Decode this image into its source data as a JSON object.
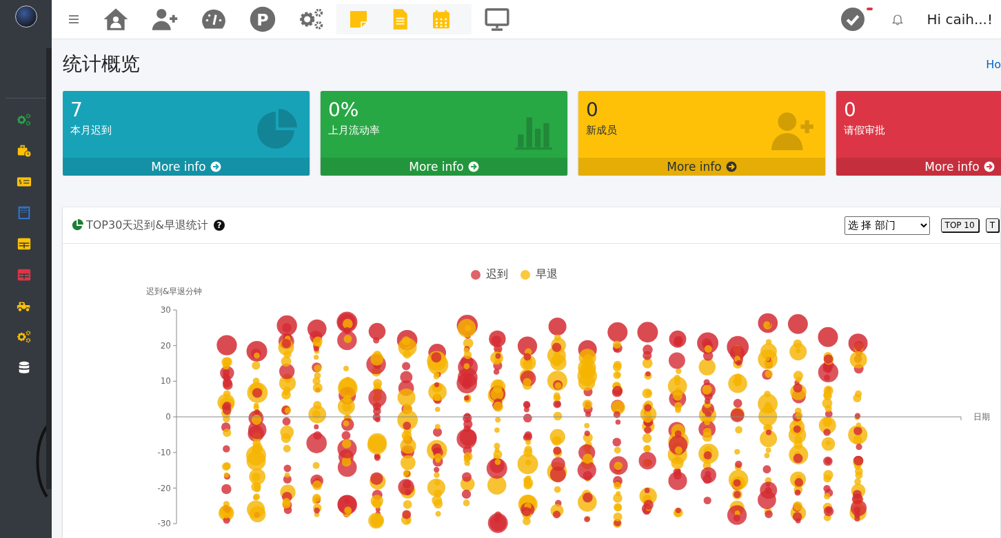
{
  "nav_icons": [
    {
      "kind": "home",
      "selected": false
    },
    {
      "kind": "user-plus",
      "selected": false
    },
    {
      "kind": "gauge",
      "selected": false
    },
    {
      "kind": "parking",
      "selected": false,
      "text": "P"
    },
    {
      "kind": "gears",
      "selected": false
    },
    {
      "kind": "note",
      "selected": true
    },
    {
      "kind": "document",
      "selected": true
    },
    {
      "kind": "calendar",
      "selected": true
    },
    {
      "kind": "monitor",
      "selected": false
    }
  ],
  "user": {
    "greeting": "Hi caih...!",
    "has_alert": true
  },
  "sidebar_items": [
    {
      "kind": "gears",
      "color": "#28a745"
    },
    {
      "kind": "briefcase",
      "color": "#ffc107"
    },
    {
      "kind": "card",
      "color": "#ffc107"
    },
    {
      "kind": "calendar",
      "color": "#2f7de1"
    },
    {
      "kind": "table",
      "color": "#ffc107"
    },
    {
      "kind": "table",
      "color": "#dc3545"
    },
    {
      "kind": "truck",
      "color": "#ffc107"
    },
    {
      "kind": "gears",
      "color": "#ffc107"
    },
    {
      "kind": "database",
      "color": "#ffffff"
    }
  ],
  "page_title": "统计概览",
  "breadcrumb": "Ho",
  "stat_boxes": [
    {
      "value": "7",
      "label": "本月迟到",
      "link": "More info",
      "color": "#17a2b8",
      "kind": "pie"
    },
    {
      "value": "0%",
      "label": "上月流动率",
      "link": "More info",
      "color": "#28a745",
      "kind": "bars"
    },
    {
      "value": "0",
      "label": "新成员",
      "link": "More info",
      "color": "#ffc107",
      "kind": "user-plus"
    },
    {
      "value": "0",
      "label": "请假审批",
      "link": "More info",
      "color": "#dc3545",
      "kind": "none"
    }
  ],
  "chart_card": {
    "title": "TOP30天迟到&早退统计",
    "help": "?",
    "department_select": "选 择 部门",
    "buttons": [
      "TOP 10",
      "T"
    ],
    "legend": [
      {
        "label": "迟到",
        "color": "#e06469"
      },
      {
        "label": "早退",
        "color": "#fcc83c"
      }
    ],
    "ylabel": "迟到&早退分钟",
    "xlabel": "日期",
    "yticks": [
      "30",
      "20",
      "10",
      "0",
      "-10",
      "-20",
      "-30"
    ]
  }
}
